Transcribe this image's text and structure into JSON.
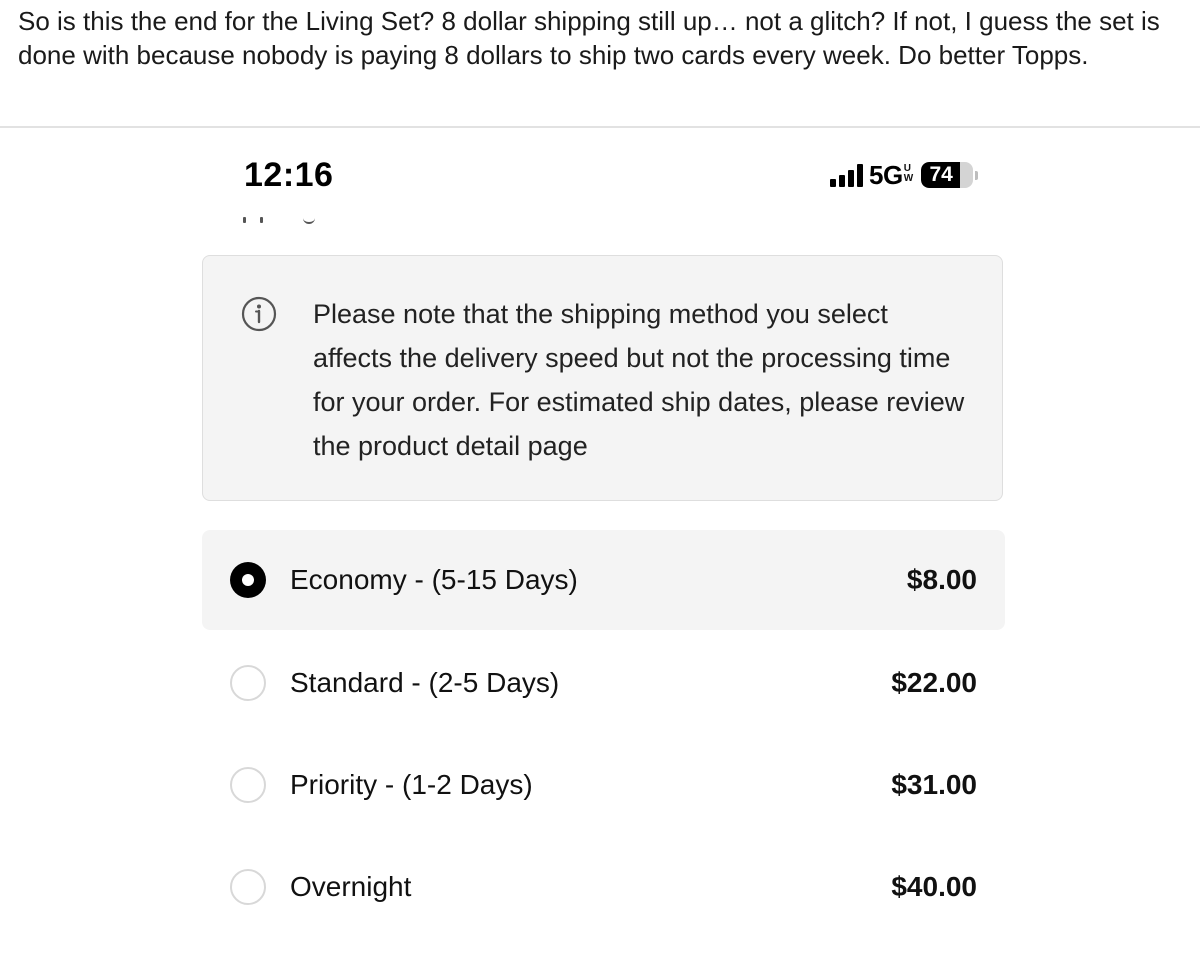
{
  "post": {
    "text": "So is this the end for the Living Set?  8 dollar shipping still up… not a glitch?  If not, I guess the set is done with because nobody is paying 8 dollars to ship two cards every week.  Do better Topps."
  },
  "status_bar": {
    "time": "12:16",
    "network": "5G",
    "network_suffix_top": "U",
    "network_suffix_bottom": "W",
    "battery_percent": "74",
    "battery_level": 0.74,
    "signal_icon": "cellular-signal-icon",
    "battery_icon": "battery-icon"
  },
  "notice": {
    "icon": "info-icon",
    "text": "Please note that the shipping method you select affects the delivery speed but not the processing time for your order. For estimated ship dates, please review the product detail page"
  },
  "shipping_options": [
    {
      "label": "Economy - (5-15 Days)",
      "price": "$8.00",
      "selected": true
    },
    {
      "label": "Standard - (2-5 Days)",
      "price": "$22.00",
      "selected": false
    },
    {
      "label": "Priority - (1-2 Days)",
      "price": "$31.00",
      "selected": false
    },
    {
      "label": "Overnight",
      "price": "$40.00",
      "selected": false
    }
  ],
  "colors": {
    "selected_row_bg": "#f4f4f4",
    "notice_bg": "#f4f4f4",
    "radio_selected": "#000000",
    "radio_unselected_border": "#d8d8d8"
  }
}
